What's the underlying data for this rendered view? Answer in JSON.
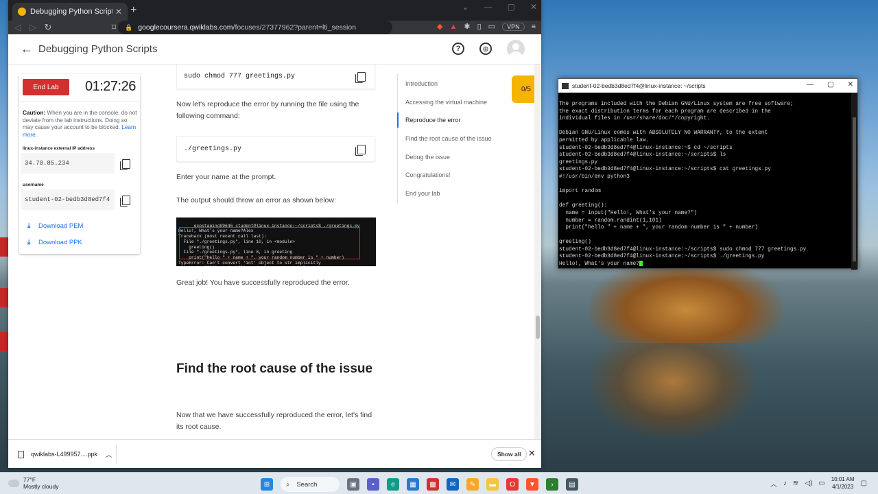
{
  "browser": {
    "tab_title": "Debugging Python Scripts | Qwik",
    "new_tab": "+",
    "url_host": "googlecoursera.qwiklabs.com",
    "url_path": "/focuses/27377962?parent=lti_session",
    "vpn": "VPN"
  },
  "app": {
    "page_title": "Debugging Python Scripts"
  },
  "lab_panel": {
    "end_lab": "End Lab",
    "timer": "01:27:26",
    "caution_bold": "Caution:",
    "caution_text": " When you are in the console, do not deviate from the lab instructions. Doing so may cause your account to be blocked. ",
    "learn_more": "Learn more.",
    "ip_label": "linux-instance external IP address",
    "ip_value": "34.70.85.234",
    "username_label": "username",
    "username_value": "student-02-bedb3d8ed7f4",
    "download_pem": "Download PEM",
    "download_ppk": "Download PPK"
  },
  "content": {
    "code1": "sudo chmod 777 greetings.py",
    "para1": "Now let's reproduce the error by running the file using the following command:",
    "code2": "./greetings.py",
    "para2": "Enter your name at the prompt.",
    "para3": "The output should throw an error as shown below:",
    "screenshot_text": "gcpstaging99646_student@linux-instance:~/scripts$ ./greetings.py\nHello!, What's your name?Alex\nTraceback (most recent call last):\n  File \"./greetings.py\", line 10, in <module>\n    greeting()\n  File \"./greetings.py\", line 8, in greeting\n    print(\"hello \" + name + \", your random number is \" + number)\nTypeError: Can't convert 'int' object to str implicitly\ngcpstaging99646_student@linux-instance:~/scripts$ ",
    "para4": "Great job! You have successfully reproduced the error.",
    "heading": "Find the root cause of the issue",
    "para5": "Now that we have successfully reproduced the error, let's find its root cause."
  },
  "toc": {
    "items": [
      "Introduction",
      "Accessing the virtual machine",
      "Reproduce the error",
      "Find the root cause of the issue",
      "Debug the issue",
      "Congratulations!",
      "End your lab"
    ],
    "score": "0/5"
  },
  "downloads": {
    "file": "qwiklabs-L499957....ppk",
    "show_all": "Show all"
  },
  "terminal": {
    "title": "student-02-bedb3d8ed7f4@linux-instance: ~/scripts",
    "output": "The programs included with the Debian GNU/Linux system are free software;\nthe exact distribution terms for each program are described in the\nindividual files in /usr/share/doc/*/copyright.\n\nDebian GNU/Linux comes with ABSOLUTELY NO WARRANTY, to the extent\npermitted by applicable law.\nstudent-02-bedb3d8ed7f4@linux-instance:~$ cd ~/scripts\nstudent-02-bedb3d8ed7f4@linux-instance:~/scripts$ ls\ngreetings.py\nstudent-02-bedb3d8ed7f4@linux-instance:~/scripts$ cat greetings.py\n#!/usr/bin/env python3\n\nimport random\n\ndef greeting():\n  name = input(\"Hello!, What's your name?\")\n  number = random.randint(1,101)\n  print(\"hello \" + name + \", your random number is \" + number)\n\ngreeting()\nstudent-02-bedb3d8ed7f4@linux-instance:~/scripts$ sudo chmod 777 greetings.py\nstudent-02-bedb3d8ed7f4@linux-instance:~/scripts$ ./greetings.py\nHello!, What's your name?"
  },
  "taskbar": {
    "temp": "77°F",
    "weather": "Mostly cloudy",
    "search": "Search",
    "time": "10:01 AM",
    "date": "4/1/2023"
  }
}
